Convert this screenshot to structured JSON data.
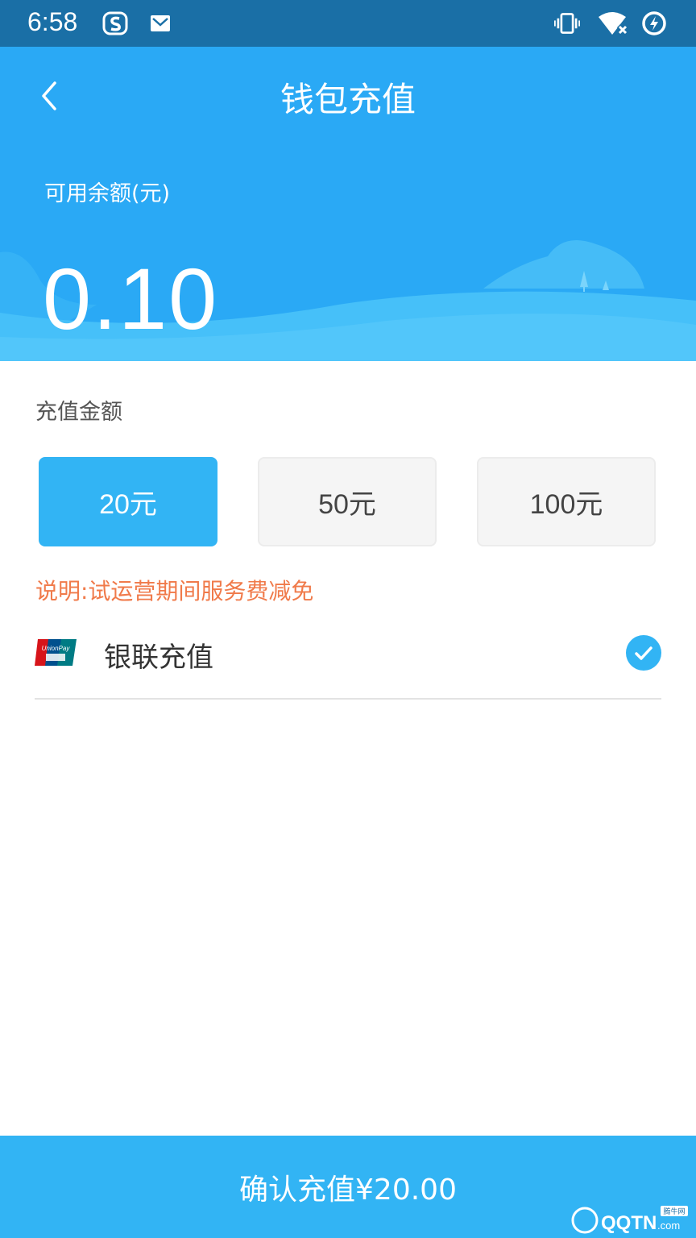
{
  "status_bar": {
    "time": "6:58"
  },
  "header": {
    "title": "钱包充值",
    "balance_label": "可用余额(元)",
    "balance_value": "0.10"
  },
  "recharge": {
    "section_label": "充值金额",
    "options": [
      {
        "label": "20元",
        "selected": true
      },
      {
        "label": "50元",
        "selected": false
      },
      {
        "label": "100元",
        "selected": false
      }
    ],
    "note": "说明:试运营期间服务费减免"
  },
  "payment": {
    "method_label": "银联充值",
    "selected": true,
    "icon": "unionpay-logo"
  },
  "footer": {
    "confirm_label": "确认充值¥20.00"
  },
  "watermark": {
    "text": "QQTN.com",
    "badge": "腾牛网"
  },
  "colors": {
    "accent": "#32b4f4",
    "header": "#2aa9f5",
    "statusbar": "#1a6fa6",
    "note": "#f07a4a"
  }
}
